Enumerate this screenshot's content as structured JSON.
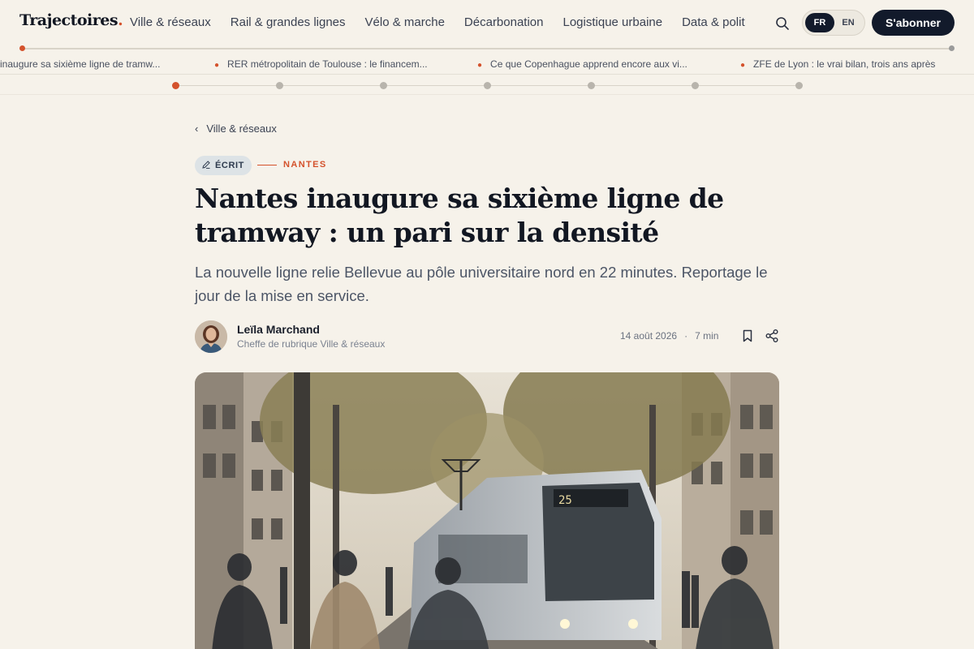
{
  "header": {
    "logo": "Trajectoires",
    "logo_dot": ".",
    "nav": [
      "Ville & réseaux",
      "Rail & grandes lignes",
      "Vélo & marche",
      "Décarbonation",
      "Logistique urbaine",
      "Data & polit"
    ],
    "lang_fr": "FR",
    "lang_en": "EN",
    "subscribe": "S'abonner",
    "search_icon": "search-icon",
    "accent_color": "#d4522c",
    "dark_color": "#121a2b"
  },
  "ticker": [
    "inaugure sa sixième ligne de tramw...",
    "RER métropolitain de Toulouse : le financem...",
    "Ce que Copenhague apprend encore aux vi...",
    "ZFE de Lyon : le vrai bilan, trois ans après"
  ],
  "carousel": {
    "count": 7,
    "active_index": 0
  },
  "article": {
    "back": "Ville & réseaux",
    "badge": "ÉCRIT",
    "kicker": "NANTES",
    "title": "Nantes inaugure sa sixième ligne de tramway : un pari sur la densité",
    "dek": "La nouvelle ligne relie Bellevue au pôle universitaire nord en 22 minutes. Reportage le jour de la mise en service.",
    "author": "Leïla Marchand",
    "role": "Cheffe de rubrique Ville & réseaux",
    "date": "14 août 2026",
    "meta_sep": "·",
    "read_time": "7 min",
    "tram_display": "25"
  }
}
